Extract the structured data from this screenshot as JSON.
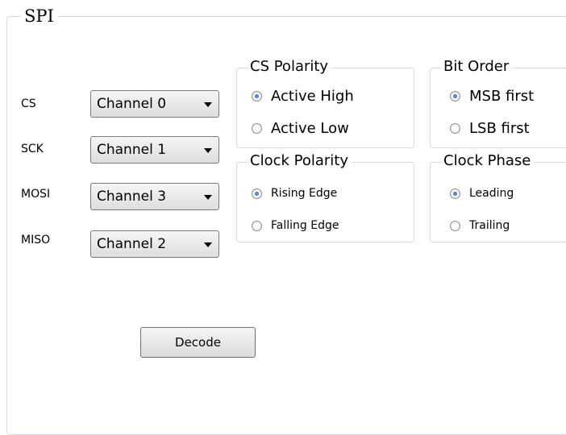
{
  "group_title": "SPI",
  "signals": [
    {
      "label": "CS",
      "channel": "Channel 0"
    },
    {
      "label": "SCK",
      "channel": "Channel 1"
    },
    {
      "label": "MOSI",
      "channel": "Channel 3"
    },
    {
      "label": "MISO",
      "channel": "Channel 2"
    }
  ],
  "cs_polarity": {
    "title": "CS Polarity",
    "options": [
      "Active High",
      "Active Low"
    ],
    "selected": "Active High"
  },
  "bit_order": {
    "title": "Bit Order",
    "options": [
      "MSB first",
      "LSB first"
    ],
    "selected": "MSB first"
  },
  "clock_polarity": {
    "title": "Clock Polarity",
    "options": [
      "Rising Edge",
      "Falling Edge"
    ],
    "selected": "Rising Edge"
  },
  "clock_phase": {
    "title": "Clock Phase",
    "options": [
      "Leading",
      "Trailing"
    ],
    "selected": "Leading"
  },
  "decode_button": "Decode",
  "icons": {
    "dropdown": "chevron-down-icon",
    "radio": "radio-button-icon"
  }
}
